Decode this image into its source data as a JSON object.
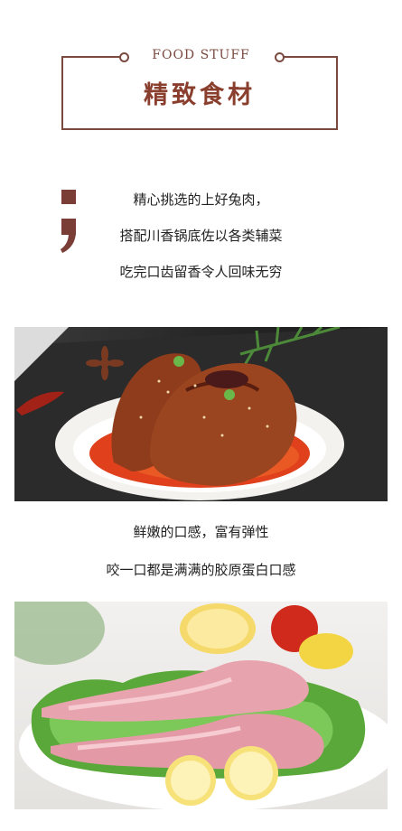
{
  "header": {
    "label_en": "FOOD STUFF",
    "title_cn": "精致食材"
  },
  "intro": {
    "lines": [
      "精心挑选的上好兔肉，",
      "搭配川香锅底佐以各类辅菜",
      "吃完口齿留香令人回味无穷"
    ]
  },
  "texture": {
    "lines": [
      "鲜嫩的口感，富有弹性",
      "咬一口都是满满的胶原蛋白口感"
    ]
  },
  "colors": {
    "accent": "#7a4a40",
    "title": "#8a3f2e",
    "text": "#222222"
  },
  "images": [
    {
      "name": "braised-rabbit-dish-photo"
    },
    {
      "name": "raw-rabbit-legs-photo"
    }
  ]
}
